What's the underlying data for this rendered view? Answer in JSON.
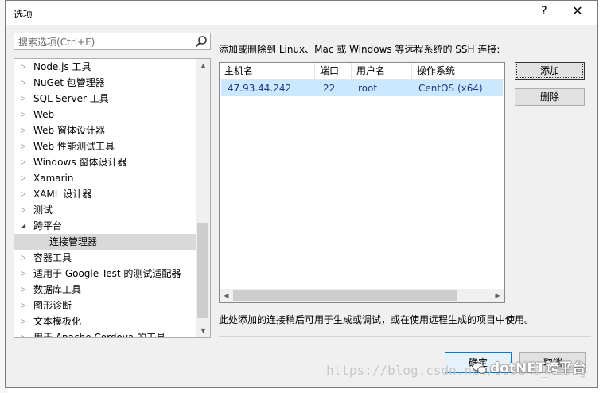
{
  "dialog": {
    "title": "选项",
    "help_label": "?",
    "close_label": "✕"
  },
  "search": {
    "placeholder": "搜索选项(Ctrl+E)"
  },
  "tree": {
    "items": [
      {
        "label": "Node.js 工具",
        "expanded": false
      },
      {
        "label": "NuGet 包管理器",
        "expanded": false
      },
      {
        "label": "SQL Server 工具",
        "expanded": false
      },
      {
        "label": "Web",
        "expanded": false
      },
      {
        "label": "Web 窗体设计器",
        "expanded": false
      },
      {
        "label": "Web 性能测试工具",
        "expanded": false
      },
      {
        "label": "Windows 窗体设计器",
        "expanded": false
      },
      {
        "label": "Xamarin",
        "expanded": false
      },
      {
        "label": "XAML 设计器",
        "expanded": false
      },
      {
        "label": "测试",
        "expanded": false
      },
      {
        "label": "跨平台",
        "expanded": true
      },
      {
        "label": "连接管理器",
        "child": true,
        "selected": true
      },
      {
        "label": "容器工具",
        "expanded": false
      },
      {
        "label": "适用于 Google Test 的测试适配器",
        "expanded": false
      },
      {
        "label": "数据库工具",
        "expanded": false
      },
      {
        "label": "图形诊断",
        "expanded": false
      },
      {
        "label": "文本模板化",
        "expanded": false
      },
      {
        "label": "用于 Apache Cordova 的工具",
        "expanded": false
      }
    ]
  },
  "main": {
    "description": "添加或删除到 Linux、Mac 或 Windows 等远程系统的 SSH 连接:",
    "columns": [
      "主机名",
      "端口",
      "用户名",
      "操作系统"
    ],
    "rows": [
      {
        "host": "47.93.44.242",
        "port": "22",
        "user": "root",
        "os": "CentOS (x64)"
      }
    ],
    "add_label": "添加",
    "delete_label": "删除",
    "note": "此处添加的连接稍后可用于生成或调试，或在使用远程生成的项目中使用。"
  },
  "footer": {
    "ok_label": "确定",
    "cancel_label": "取消"
  },
  "watermark": {
    "url": "https://blog.csdn.net/soband_xiang",
    "brand": "dotNET跨平台"
  }
}
